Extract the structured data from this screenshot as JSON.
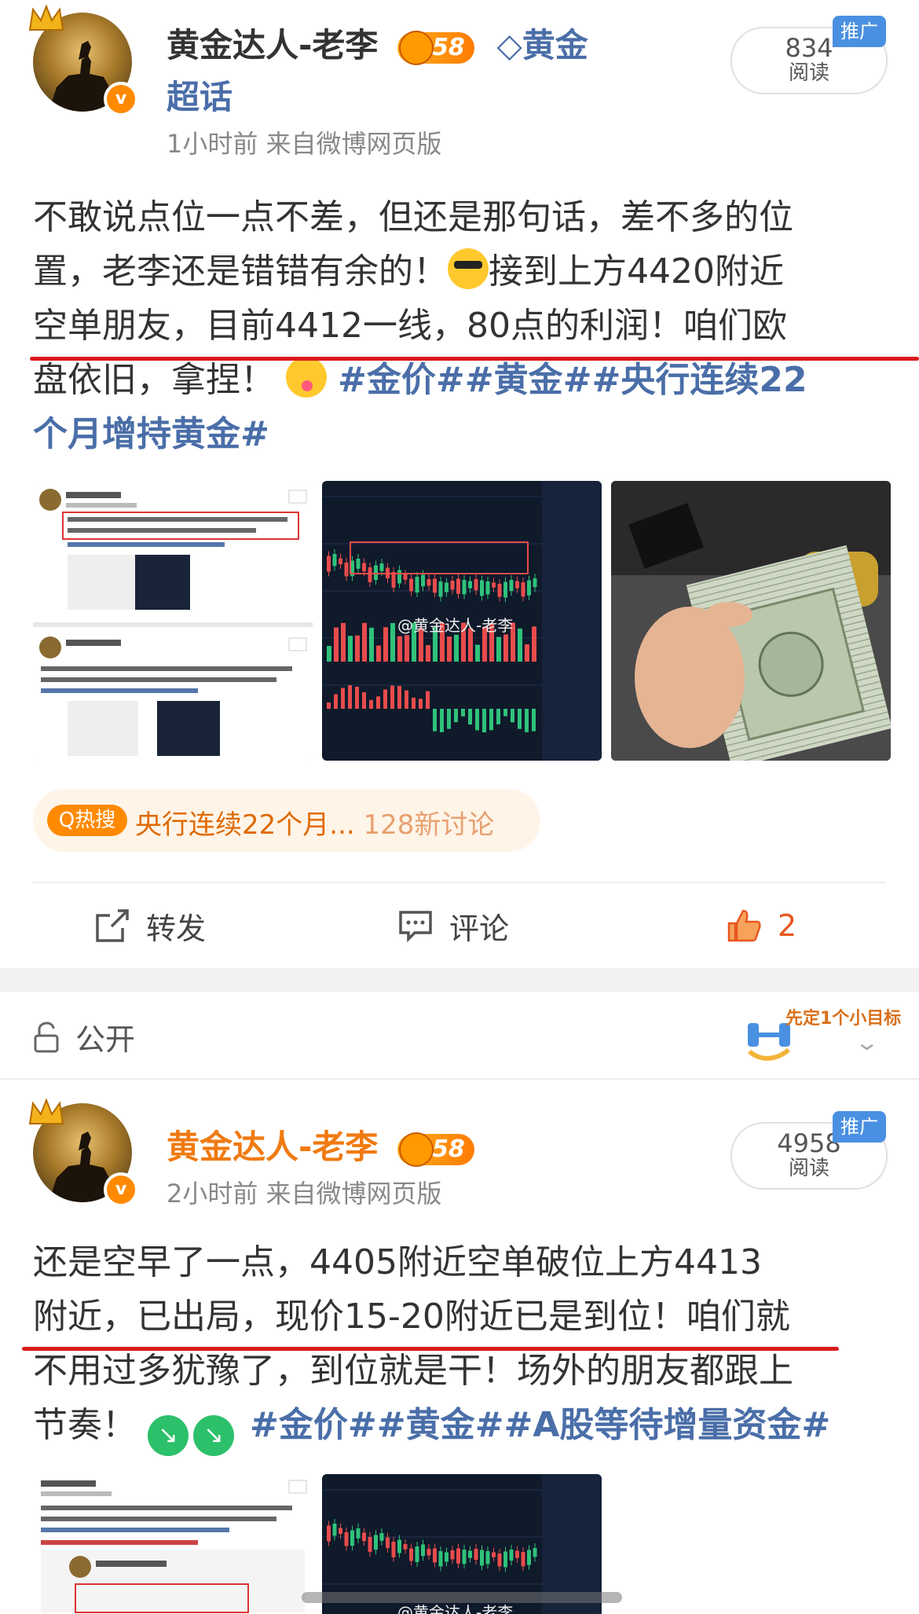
{
  "post1": {
    "username": "黄金达人-老李",
    "level": "58",
    "topic": "黄金",
    "topic_line2": "超话",
    "meta": "1小时前  来自微博网页版",
    "reads": {
      "num": "834",
      "label": "阅读"
    },
    "promo": "推广",
    "body": {
      "l1": "不敢说点位一点不差，但还是那句话，差不多的位",
      "l2a": "置，老李还是错错有余的！",
      "l2b": "接到上方4420附近",
      "l3": "空单朋友，目前4412一线，80点的利润！咱们欧",
      "l4a": "盘依旧，拿捏！",
      "l4tag": "#金价##黄金##央行连续22",
      "l5tag": "个月增持黄金#"
    },
    "hot": {
      "badge": "Q热搜",
      "text": "央行连续22个月...",
      "extra": "128新讨论"
    },
    "actions": {
      "repost": "转发",
      "comment": "评论",
      "like": "2"
    },
    "chart_watermark": "@黄金达人-老李"
  },
  "visibility": {
    "label": "公开",
    "goal_text": "先定1个小目标"
  },
  "post2": {
    "username": "黄金达人-老李",
    "level": "58",
    "meta": "2小时前  来自微博网页版",
    "reads": {
      "num": "4958",
      "label": "阅读"
    },
    "promo": "推广",
    "body": {
      "l1": "还是空早了一点，4405附近空单破位上方4413",
      "l2": "附近，已出局，现价15-20附近已是到位！咱们就",
      "l3": "不用过多犹豫了，到位就是干！场外的朋友都跟上",
      "l4a": "节奏！",
      "l4tag": "#金价##黄金##A股等待增量资金#"
    },
    "chart_watermark": "@黄金达人-老李"
  },
  "colors": {
    "orange": "#ff8a00",
    "link": "#4a6ea8",
    "red": "#d91a1a",
    "chart_bg": "#0f1a2b"
  }
}
